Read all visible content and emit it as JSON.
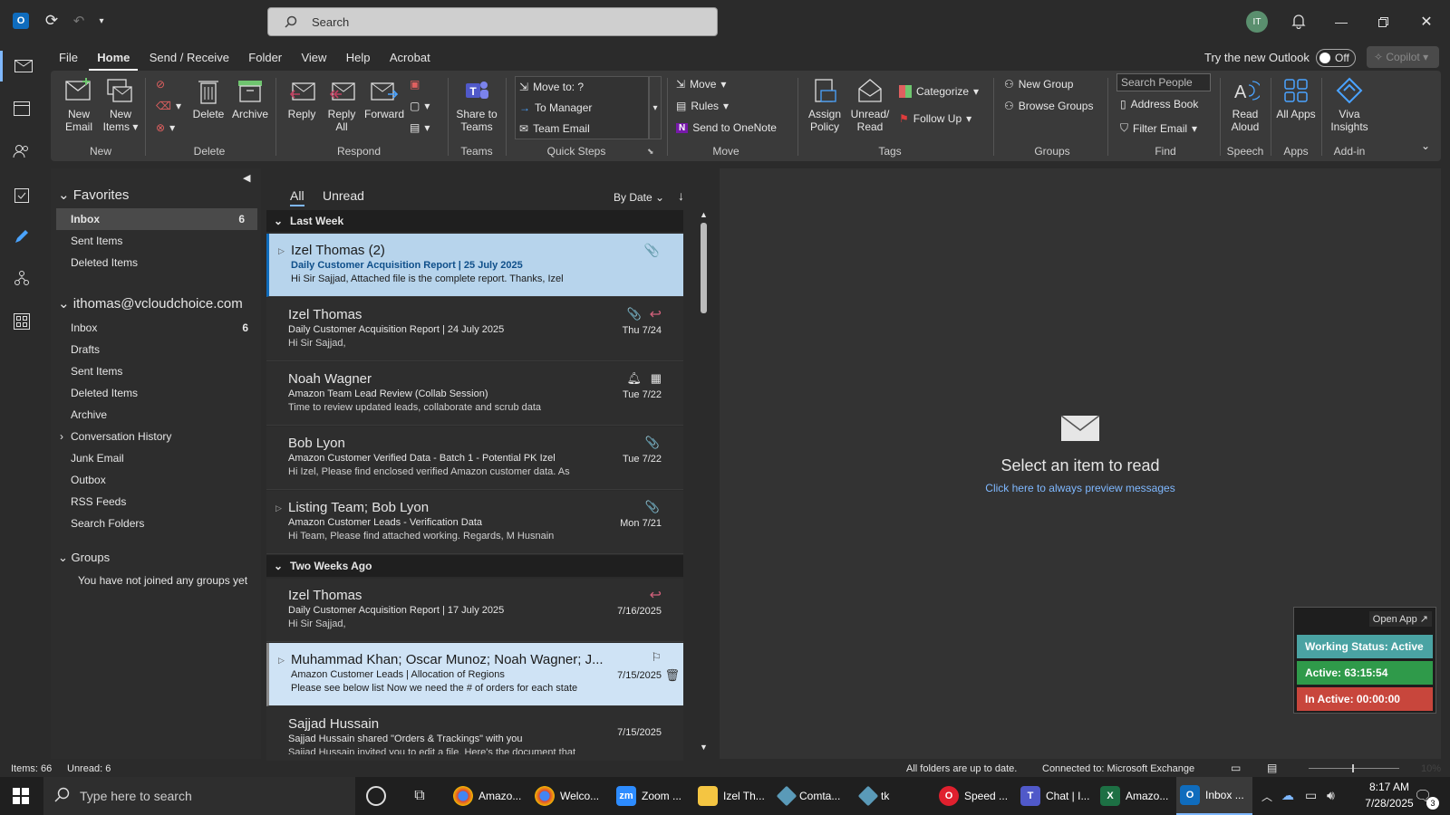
{
  "titlebar": {
    "search_placeholder": "Search",
    "avatar_initials": "IT"
  },
  "menu": {
    "items": [
      "File",
      "Home",
      "Send / Receive",
      "Folder",
      "View",
      "Help",
      "Acrobat"
    ],
    "active": "Home",
    "try_new_outlook": "Try the new Outlook",
    "toggle_label": "Off",
    "copilot": "Copilot"
  },
  "ribbon": {
    "new_email": "New Email",
    "new_items": "New Items",
    "delete": "Delete",
    "archive": "Archive",
    "reply": "Reply",
    "reply_all": "Reply All",
    "forward": "Forward",
    "share_to_teams": "Share to Teams",
    "qs_move_to": "Move to: ?",
    "qs_to_manager": "To Manager",
    "qs_team_email": "Team Email",
    "move": "Move",
    "rules": "Rules",
    "send_to_onenote": "Send to OneNote",
    "assign_policy": "Assign Policy",
    "unread_read": "Unread/ Read",
    "categorize": "Categorize",
    "follow_up": "Follow Up",
    "new_group": "New Group",
    "browse_groups": "Browse Groups",
    "search_people": "Search People",
    "address_book": "Address Book",
    "filter_email": "Filter Email",
    "read_aloud": "Read Aloud",
    "all_apps": "All Apps",
    "viva_insights": "Viva Insights",
    "groups": {
      "new": "New",
      "delete": "Delete",
      "respond": "Respond",
      "teams": "Teams",
      "quick_steps": "Quick Steps",
      "move": "Move",
      "tags": "Tags",
      "groups": "Groups",
      "find": "Find",
      "speech": "Speech",
      "apps": "Apps",
      "addin": "Add-in"
    }
  },
  "folders": {
    "favorites_label": "Favorites",
    "favorites": [
      {
        "label": "Inbox",
        "count": "6"
      },
      {
        "label": "Sent Items",
        "count": ""
      },
      {
        "label": "Deleted Items",
        "count": ""
      }
    ],
    "account": "ithomas@vcloudchoice.com",
    "account_items": [
      {
        "label": "Inbox",
        "count": "6"
      },
      {
        "label": "Drafts",
        "count": ""
      },
      {
        "label": "Sent Items",
        "count": ""
      },
      {
        "label": "Deleted Items",
        "count": ""
      },
      {
        "label": "Archive",
        "count": ""
      },
      {
        "label": "Conversation History",
        "count": ""
      },
      {
        "label": "Junk Email",
        "count": ""
      },
      {
        "label": "Outbox",
        "count": ""
      },
      {
        "label": "RSS Feeds",
        "count": ""
      },
      {
        "label": "Search Folders",
        "count": ""
      }
    ],
    "groups_label": "Groups",
    "groups_empty": "You have not joined any groups yet"
  },
  "list": {
    "tab_all": "All",
    "tab_unread": "Unread",
    "sort_label": "By Date",
    "group_last_week": "Last Week",
    "group_two_weeks": "Two Weeks Ago",
    "messages": [
      {
        "sender": "Izel Thomas  (2)",
        "subject": "Daily Customer Acquisition Report | 25 July 2025",
        "preview": "Hi Sir Sajjad,  Attached file is the complete report.  Thanks,  Izel",
        "date": ""
      },
      {
        "sender": "Izel Thomas",
        "subject": "Daily Customer Acquisition Report | 24 July 2025",
        "preview": "Hi Sir Sajjad,",
        "date": "Thu 7/24"
      },
      {
        "sender": "Noah Wagner",
        "subject": "Amazon Team Lead Review (Collab Session)",
        "preview": "Time to review updated leads, collaborate and scrub data",
        "date": "Tue 7/22"
      },
      {
        "sender": "Bob Lyon",
        "subject": "Amazon Customer Verified Data -  Batch 1 - Potential PK Izel",
        "preview": "Hi Izel,  Please find enclosed verified Amazon customer data.  As",
        "date": "Tue 7/22"
      },
      {
        "sender": "Listing Team;  Bob Lyon",
        "subject": "Amazon Customer Leads -  Verification Data",
        "preview": "Hi Team,  Please find attached working.  Regards,  M Husnain",
        "date": "Mon 7/21"
      },
      {
        "sender": "Izel Thomas",
        "subject": "Daily Customer Acquisition Report | 17 July 2025",
        "preview": "Hi Sir Sajjad,",
        "date": "7/16/2025"
      },
      {
        "sender": "Muhammad Khan;  Oscar Munoz;  Noah Wagner;  J...",
        "subject": "Amazon Customer Leads | Allocation of Regions",
        "preview": "Please see below list  Now we need the # of orders for each state",
        "date": "7/15/2025"
      },
      {
        "sender": "Sajjad Hussain",
        "subject": "Sajjad Hussain shared \"Orders & Trackings\" with you",
        "preview": "Sajjad Hussain invited you to edit a file.  Here's the document that",
        "date": "7/15/2025"
      }
    ]
  },
  "reading": {
    "title": "Select an item to read",
    "link": "Click here to always preview messages"
  },
  "widget": {
    "open_app": "Open App ↗",
    "working_status": "Working Status: Active",
    "active": "Active: 63:15:54",
    "inactive": "In Active: 00:00:00"
  },
  "status": {
    "items": "Items: 66",
    "unread": "Unread: 6",
    "folders": "All folders are up to date.",
    "connected": "Connected to: Microsoft Exchange",
    "zoom": "10%"
  },
  "taskbar": {
    "search_placeholder": "Type here to search",
    "apps": [
      "Amazo...",
      "Welco...",
      "Zoom ...",
      "Izel Th...",
      "Comta...",
      "tk",
      "Speed ...",
      "Chat | I...",
      "Amazo...",
      "Inbox ..."
    ],
    "time": "8:17 AM",
    "date": "7/28/2025",
    "notif_count": "3"
  }
}
